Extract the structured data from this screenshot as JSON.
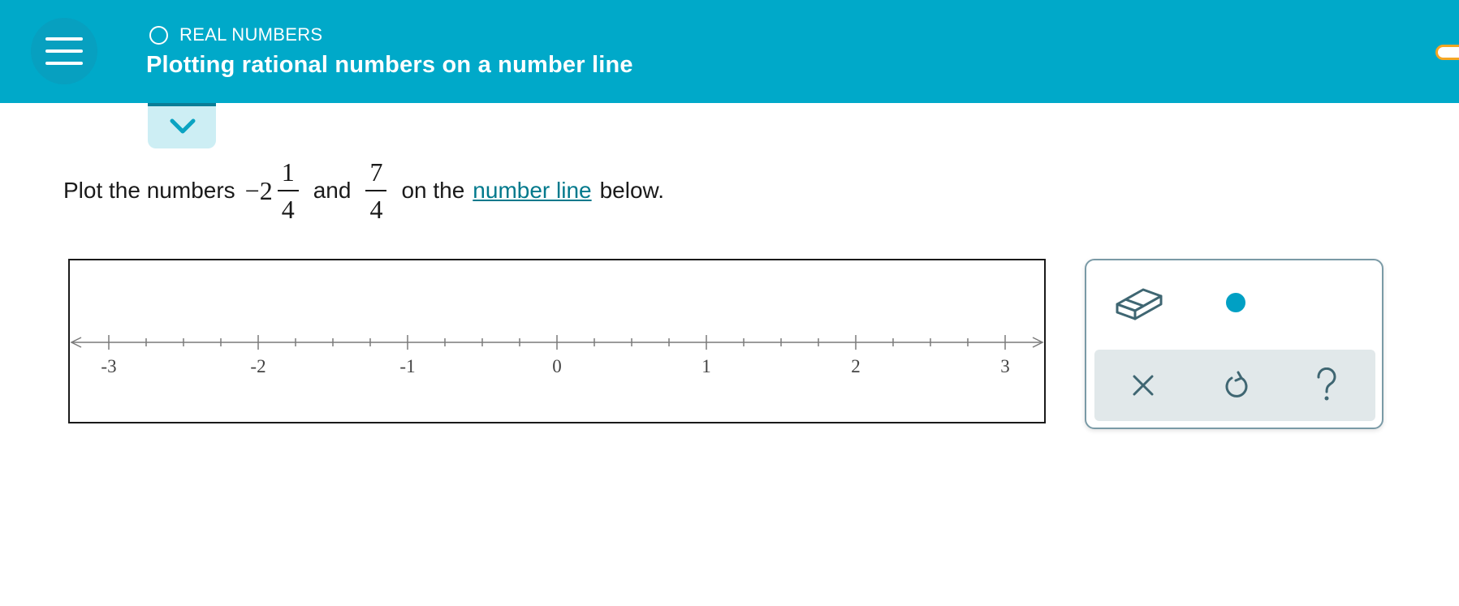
{
  "header": {
    "topic": "REAL NUMBERS",
    "title": "Plotting rational numbers on a number line"
  },
  "question": {
    "prefix": "Plot the numbers",
    "mixed": {
      "sign": "−",
      "whole": "2",
      "numerator": "1",
      "denominator": "4"
    },
    "and": "and",
    "fraction": {
      "numerator": "7",
      "denominator": "4"
    },
    "on_the": "on the",
    "link": "number line",
    "suffix": "below."
  },
  "number_line": {
    "min": -3,
    "max": 3,
    "major_step": 1,
    "minor_step": 0.25,
    "labels": [
      "-3",
      "-2",
      "-1",
      "0",
      "1",
      "2",
      "3"
    ]
  },
  "tools": {
    "eraser": "eraser-icon",
    "point": "point-dot-icon",
    "clear": "close-icon",
    "undo": "undo-icon",
    "help": "help-icon"
  },
  "colors": {
    "header": "#00a9c9",
    "accent": "#00a0c4",
    "link": "#00798c",
    "toolbar": "#e1e8ea"
  }
}
